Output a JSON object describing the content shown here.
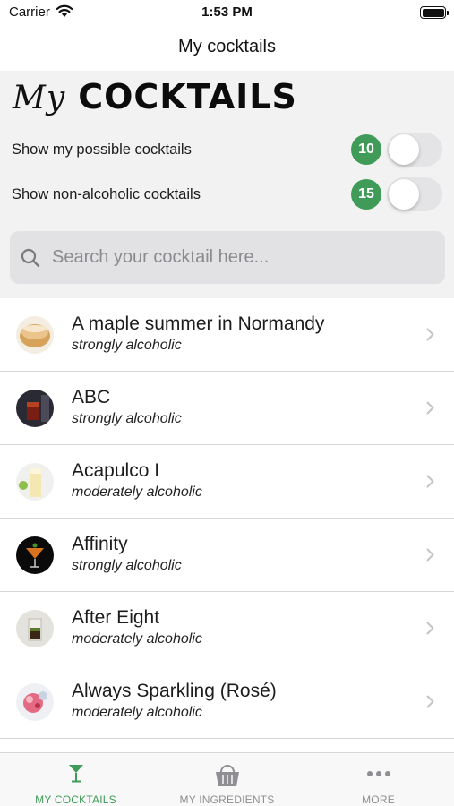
{
  "status_bar": {
    "carrier": "Carrier",
    "time": "1:53 PM"
  },
  "nav": {
    "title": "My cocktails"
  },
  "header": {
    "logo_my": "My",
    "logo_word": "COCKTAILS",
    "toggles": [
      {
        "label": "Show my possible cocktails",
        "count": "10",
        "on": false
      },
      {
        "label": "Show non-alcoholic cocktails",
        "count": "15",
        "on": false
      }
    ]
  },
  "search": {
    "placeholder": "Search your cocktail here..."
  },
  "cocktails": [
    {
      "name": "A maple summer in Normandy",
      "strength": "strongly alcoholic",
      "thumb_icon": "amber-glass-icon"
    },
    {
      "name": "ABC",
      "strength": "strongly alcoholic",
      "thumb_icon": "dark-red-glass-icon"
    },
    {
      "name": "Acapulco I",
      "strength": "moderately alcoholic",
      "thumb_icon": "lime-glass-icon"
    },
    {
      "name": "Affinity",
      "strength": "strongly alcoholic",
      "thumb_icon": "martini-glass-icon"
    },
    {
      "name": "After Eight",
      "strength": "moderately alcoholic",
      "thumb_icon": "shot-glass-icon"
    },
    {
      "name": "Always Sparkling (Rosé)",
      "strength": "moderately alcoholic",
      "thumb_icon": "rose-glass-icon"
    }
  ],
  "tabs": [
    {
      "label": "MY COCKTAILS",
      "icon": "cocktail-glass-icon",
      "active": true
    },
    {
      "label": "MY INGREDIENTS",
      "icon": "basket-icon",
      "active": false
    },
    {
      "label": "MORE",
      "icon": "more-dots-icon",
      "active": false
    }
  ],
  "colors": {
    "accent": "#3f9b57",
    "header_bg": "#f2f2f3",
    "search_bg": "#e2e2e5",
    "switch_off": "#e4e4e6"
  }
}
